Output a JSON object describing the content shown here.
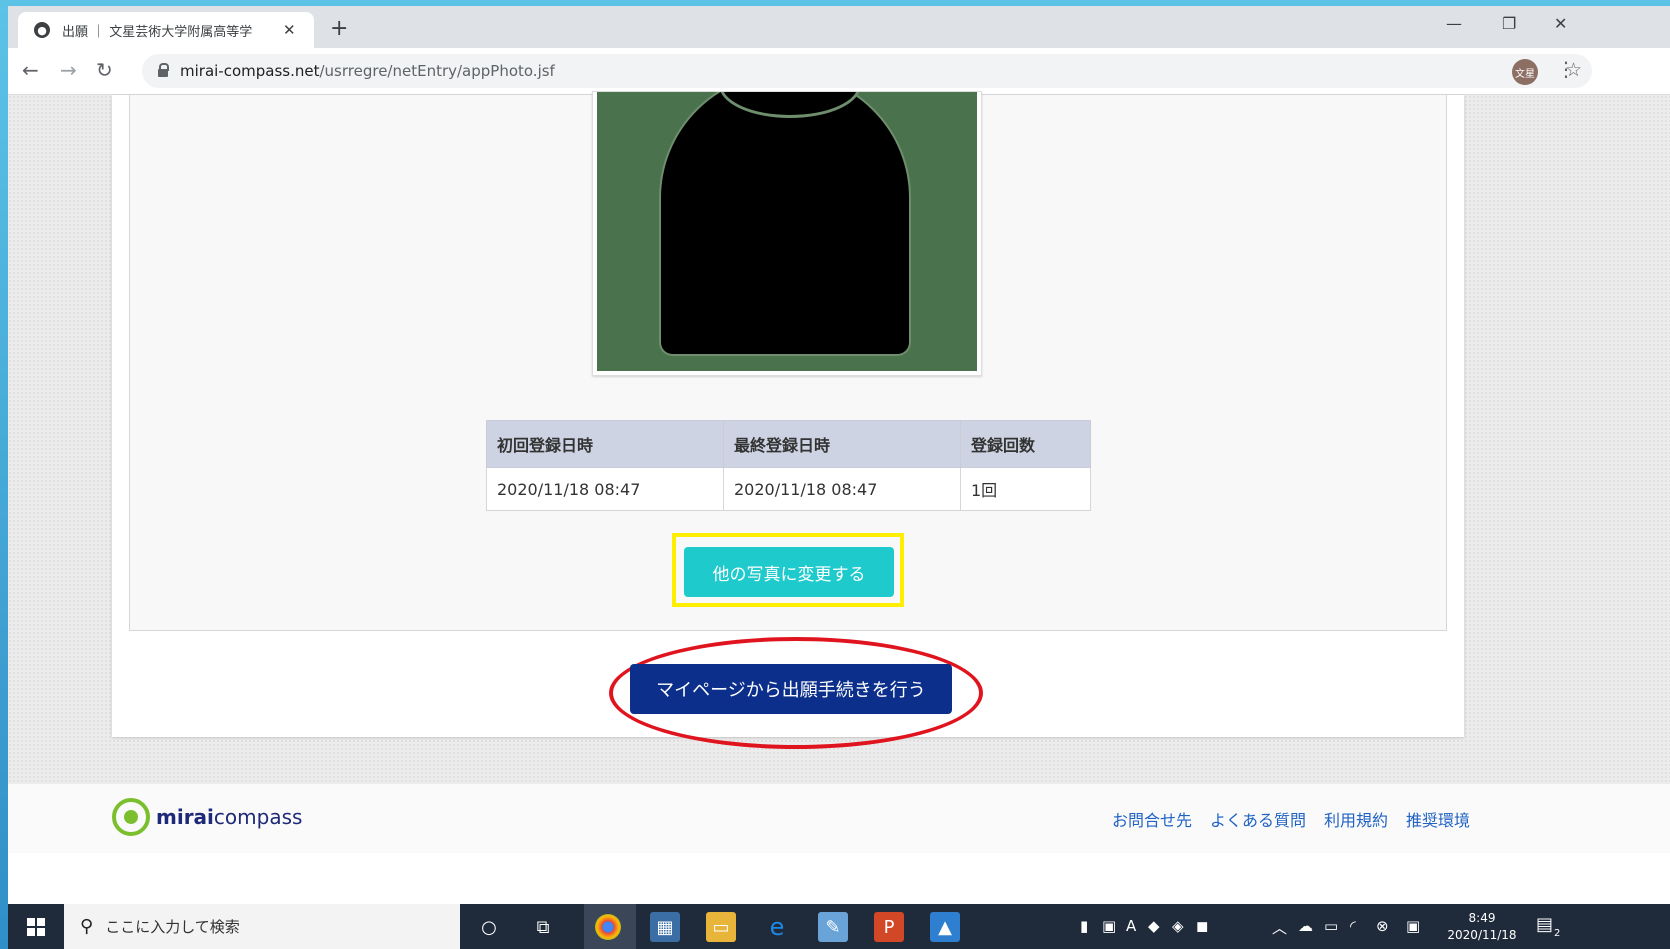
{
  "browser": {
    "tab_title": "出願 ｜ 文星芸術大学附属高等学",
    "tab_close": "✕",
    "new_tab": "+",
    "url_host": "mirai-compass.net",
    "url_path": "/usrregre/netEntry/appPhoto.jsf",
    "profile_initials": "文星",
    "window_controls": {
      "minimize": "—",
      "restore": "❐",
      "close": "✕"
    }
  },
  "registration_table": {
    "headers": [
      "初回登録日時",
      "最終登録日時",
      "登録回数"
    ],
    "row": [
      "2020/11/18 08:47",
      "2020/11/18 08:47",
      "1回"
    ]
  },
  "buttons": {
    "change_photo": "他の写真に変更する",
    "apply_from_mypage": "マイページから出願手続きを行う"
  },
  "footer": {
    "logo_bold": "mirai",
    "logo_rest": "compass",
    "links": [
      "お問合せ先",
      "よくある質問",
      "利用規約",
      "推奨環境"
    ]
  },
  "taskbar": {
    "search_placeholder": "ここに入力して検索",
    "time": "8:49",
    "date": "2020/11/18",
    "notification_count": "2"
  },
  "colors": {
    "accent_teal": "#1ecacb",
    "primary_navy": "#0b2f8a",
    "highlight_yellow": "#ffee00",
    "annotation_red": "#e0141e",
    "photo_background": "#4a724d"
  }
}
